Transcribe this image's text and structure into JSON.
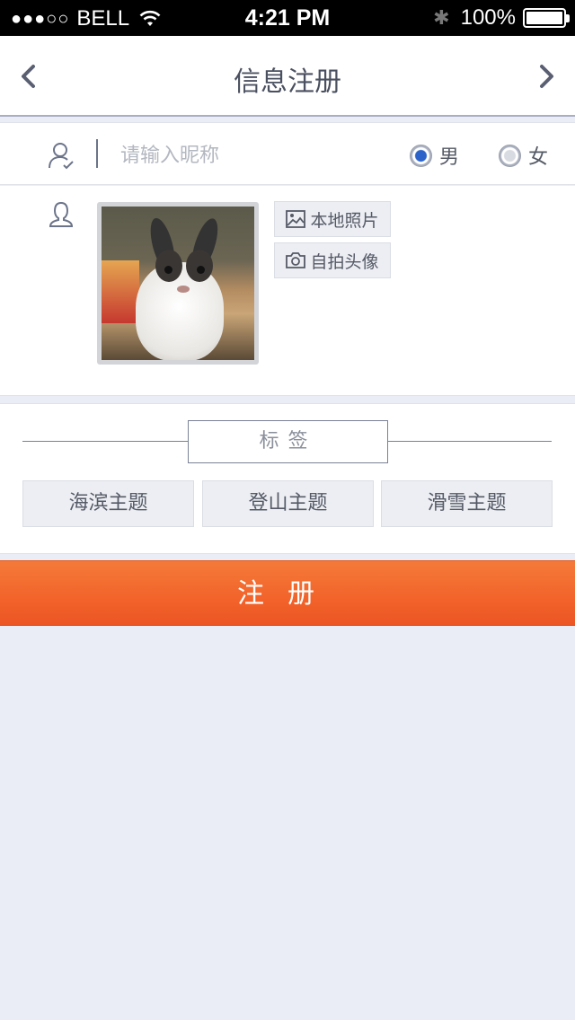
{
  "status_bar": {
    "signal": "●●●○○",
    "carrier": "BELL",
    "time": "4:21 PM",
    "battery": "100%"
  },
  "nav": {
    "title": "信息注册",
    "back_icon": "chevron-left-icon",
    "forward_icon": "chevron-right-icon"
  },
  "nickname": {
    "placeholder": "请输入昵称",
    "value": "",
    "icon": "user-check-icon"
  },
  "gender": {
    "selected": "男",
    "options": [
      {
        "label": "男",
        "checked": true
      },
      {
        "label": "女",
        "checked": false
      }
    ]
  },
  "avatar": {
    "icon": "person-outline-icon",
    "image": "rabbit-photo",
    "local_photo_label": "本地照片",
    "selfie_label": "自拍头像"
  },
  "tags": {
    "title": "标签",
    "items": [
      "海滨主题",
      "登山主题",
      "滑雪主题"
    ]
  },
  "register": {
    "label": "注册"
  },
  "colors": {
    "accent": "#f26a2e",
    "background": "#eaedf5",
    "radio_selected": "#2a62c9"
  }
}
